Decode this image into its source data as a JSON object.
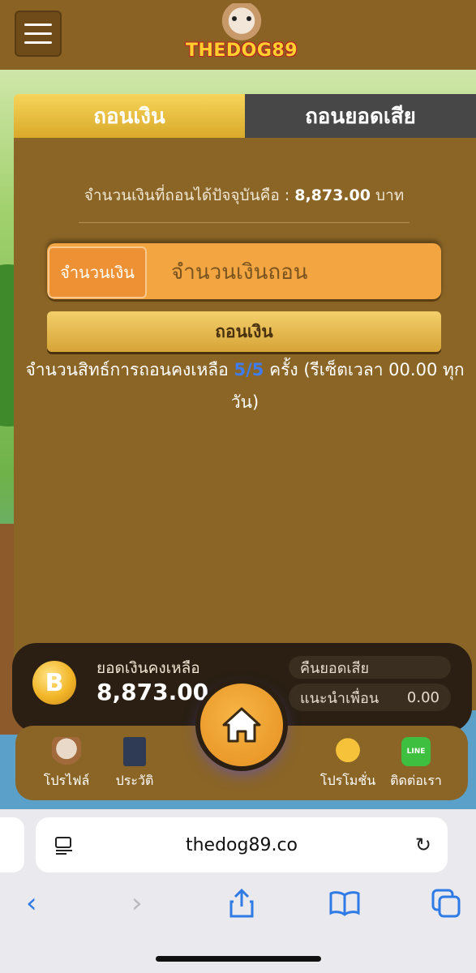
{
  "header": {
    "logo_text": "THEDOG89",
    "menu_icon": "hamburger-menu-icon"
  },
  "tabs": [
    {
      "label": "ถอนเงิน",
      "active": true
    },
    {
      "label": "ถอนยอดเสีย",
      "active": false
    }
  ],
  "withdraw": {
    "available_prefix": "จำนวนเงินที่ถอนได้ปัจจุบันคือ :",
    "available_amount": "8,873.00",
    "available_unit": "บาท",
    "amount_label": "จำนวนเงิน",
    "amount_placeholder": "จำนวนเงินถอน",
    "amount_value": "",
    "submit_label": "ถอนเงิน",
    "rights_prefix": "จำนวนสิทธ์การถอนคงเหลือ",
    "rights_count": "5/5",
    "rights_suffix": "ครั้ง (รีเซ็ตเวลา 00.00 ทุกวัน)"
  },
  "balance": {
    "label": "ยอดเงินคงเหลือ",
    "value": "8,873.00",
    "coin_symbol": "B",
    "cashback_label": "คืนยอดเสีย",
    "cashback_value": "",
    "referral_label": "แนะนำเพื่อน",
    "referral_value": "0.00"
  },
  "nav": {
    "profile": "โปรไฟล์",
    "history": "ประวัติ",
    "promotion": "โปรโมชั่น",
    "contact": "ติดต่อเรา",
    "line_text": "LINE"
  },
  "browser": {
    "url": "thedog89.co"
  },
  "colors": {
    "header": "#8a6224",
    "panel": "#8b6526",
    "active_tab": "#f0c84a",
    "inactive_tab": "#474747",
    "highlight": "#3d7df0",
    "ios_blue": "#2f7ae5"
  }
}
